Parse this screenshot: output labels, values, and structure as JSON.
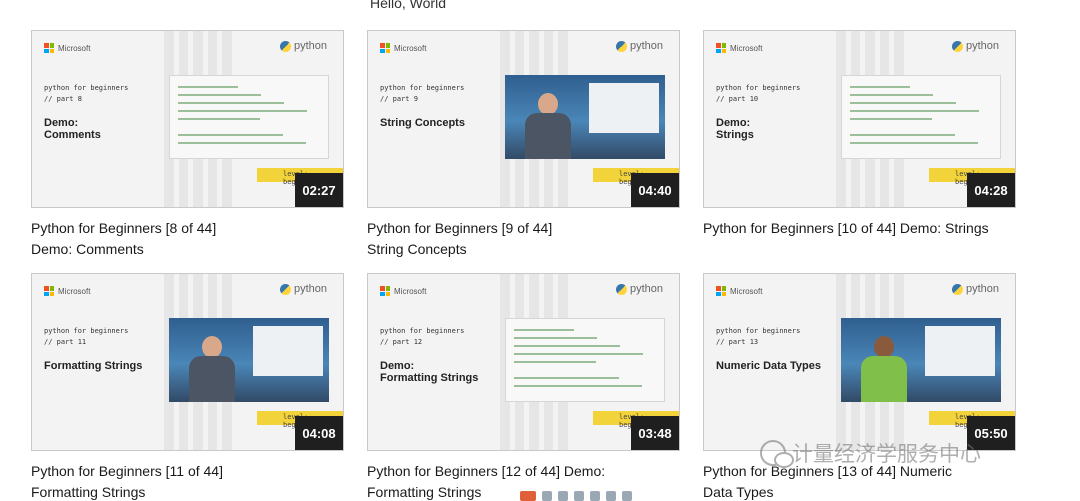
{
  "top_caption": "Hello, World",
  "brand": {
    "microsoft": "Microsoft",
    "python": "python"
  },
  "colors": {
    "level_badge": "#f3d33a",
    "duration_bg": "#1f1f1f"
  },
  "level_text": "level: beginner",
  "videos": [
    {
      "series": "python for beginners",
      "part": "// part 8",
      "topic": "Demo:\nComments",
      "duration": "02:27",
      "title_line1": "Python for Beginners [8 of 44]",
      "title_line2": "Demo: Comments",
      "thumb": "code"
    },
    {
      "series": "python for beginners",
      "part": "// part 9",
      "topic": "String Concepts",
      "duration": "04:40",
      "title_line1": "Python for Beginners [9 of 44]",
      "title_line2": "String Concepts",
      "thumb": "video"
    },
    {
      "series": "python for beginners",
      "part": "// part 10",
      "topic": "Demo:\nStrings",
      "duration": "04:28",
      "title_line1": "Python for Beginners [10 of 44] Demo: Strings",
      "title_line2": "",
      "thumb": "code"
    },
    {
      "series": "python for beginners",
      "part": "// part 11",
      "topic": "Formatting Strings",
      "duration": "04:08",
      "title_line1": "Python for Beginners [11 of 44]",
      "title_line2": "Formatting Strings",
      "thumb": "video"
    },
    {
      "series": "python for beginners",
      "part": "// part 12",
      "topic": "Demo:\nFormatting Strings",
      "duration": "03:48",
      "title_line1": "Python for Beginners [12 of 44] Demo:",
      "title_line2": "Formatting Strings",
      "thumb": "code"
    },
    {
      "series": "python for beginners",
      "part": "// part 13",
      "topic": "Numeric Data Types",
      "duration": "05:50",
      "title_line1": "Python for Beginners [13 of 44] Numeric",
      "title_line2": "Data Types",
      "thumb": "video-green"
    }
  ],
  "watermark": "计量经济学服务中心"
}
